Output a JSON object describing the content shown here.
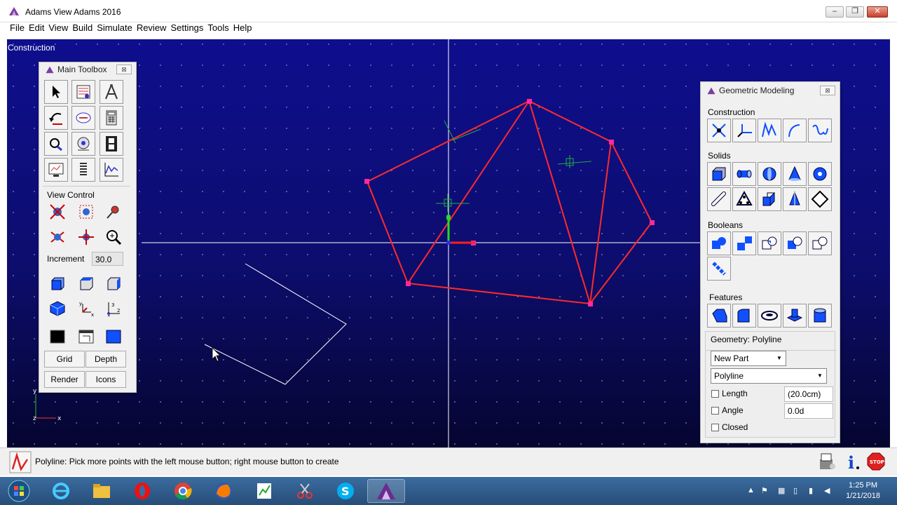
{
  "window": {
    "title": "Adams View Adams 2016"
  },
  "menu": [
    "File",
    "Edit",
    "View",
    "Build",
    "Simulate",
    "Review",
    "Settings",
    "Tools",
    "Help"
  ],
  "viewport": {
    "label": "Construction",
    "axes": {
      "x": "x",
      "y": "y",
      "z": "z"
    }
  },
  "main_toolbox": {
    "title": "Main Toolbox",
    "view_control_label": "View Control",
    "increment_label": "Increment",
    "increment_value": "30.0",
    "buttons": {
      "grid": "Grid",
      "depth": "Depth",
      "render": "Render",
      "icons": "Icons"
    }
  },
  "geometric_modeling": {
    "title": "Geometric Modeling",
    "sections": {
      "construction": "Construction",
      "solids": "Solids",
      "booleans": "Booleans",
      "features": "Features"
    },
    "geometry_label": "Geometry: Polyline",
    "part_select": "New Part",
    "type_select": "Polyline",
    "length_label": "Length",
    "length_value": "(20.0cm)",
    "angle_label": "Angle",
    "angle_value": "0.0d",
    "closed_label": "Closed"
  },
  "status": {
    "text": "Polyline: Pick more points with the left mouse button; right mouse button to create"
  },
  "taskbar": {
    "time": "1:25 PM",
    "date": "1/21/2018"
  },
  "colors": {
    "viewport_top": "#0e0e8e",
    "polyline": "#ff2a2a",
    "vertex": "#ff2a9a",
    "marker": "#22aa44"
  }
}
